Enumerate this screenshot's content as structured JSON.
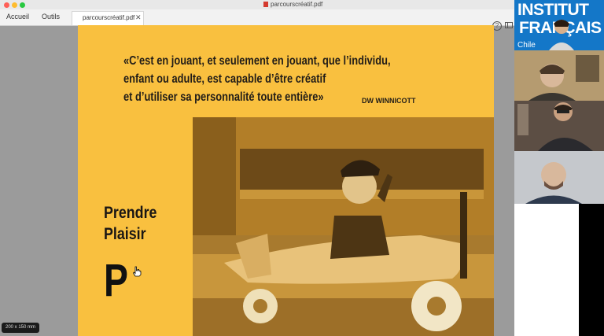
{
  "window": {
    "title": "parcourscréatif.pdf"
  },
  "toolbar": {
    "home": "Accueil",
    "tools": "Outils",
    "tab_title": "parcourscréatif.pdf",
    "tab_close": "✕",
    "help": "?"
  },
  "slide": {
    "quote_lines": [
      "«C’est en jouant, et seulement en jouant, que l’individu,",
      "enfant ou adulte, est capable d’être créatif",
      "et d’utiliser sa personnalité toute entière»"
    ],
    "author": "DW WINNICOTT",
    "caption_line1": "Prendre",
    "caption_line2": "Plaisir",
    "letter": "P"
  },
  "status": {
    "page_size": "200 x 150 mm"
  },
  "video": {
    "logo_line1": "INSTITUT",
    "logo_line2": "FRANÇAIS",
    "logo_sub": "Chile"
  },
  "colors": {
    "slide_bg": "#f9c03f",
    "logo_blue": "#1477c8",
    "photo_tint": "#e0a838"
  }
}
